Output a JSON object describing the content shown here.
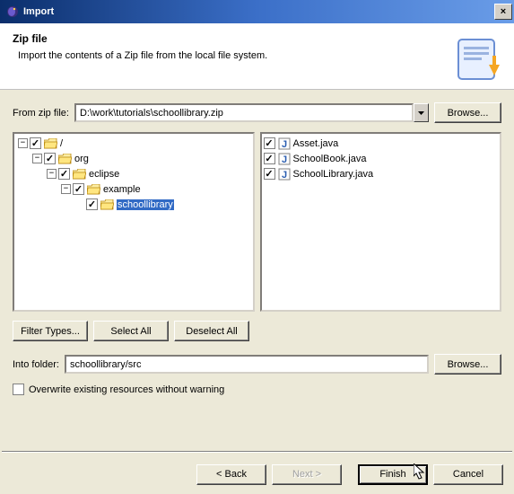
{
  "titlebar": {
    "title": "Import",
    "close_icon": "×"
  },
  "header": {
    "heading": "Zip file",
    "desc": "Import the contents of a Zip file from the local file system."
  },
  "zip_row": {
    "label": "From zip file:",
    "value": "D:\\work\\tutorials\\schoollibrary.zip",
    "browse": "Browse..."
  },
  "tree": {
    "root": "/",
    "n1": "org",
    "n2": "eclipse",
    "n3": "example",
    "n4": "schoollibrary"
  },
  "files": {
    "f1": "Asset.java",
    "f2": "SchoolBook.java",
    "f3": "SchoolLibrary.java"
  },
  "buttons": {
    "filter": "Filter Types...",
    "select_all": "Select All",
    "deselect_all": "Deselect All"
  },
  "into": {
    "label": "Into folder:",
    "value": "schoollibrary/src",
    "browse": "Browse..."
  },
  "overwrite": {
    "label": "Overwrite existing resources without warning"
  },
  "footer": {
    "back": "< Back",
    "next": "Next >",
    "finish": "Finish",
    "cancel": "Cancel"
  }
}
